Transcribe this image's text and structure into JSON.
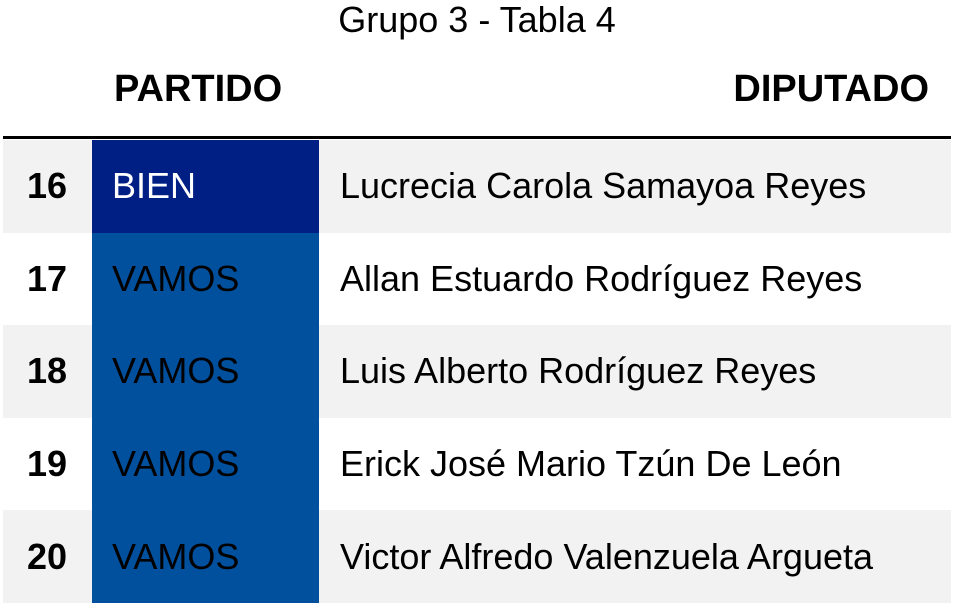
{
  "title": "Grupo 3 - Tabla 4",
  "header": {
    "partido": "PARTIDO",
    "diputado": "DIPUTADO"
  },
  "colors": {
    "BIEN": "#001f84",
    "VAMOS": "#00509e",
    "bien_text": "#ffffff",
    "vamos_text": "#000000"
  },
  "rows": [
    {
      "num": "16",
      "party": "BIEN",
      "name": "Lucrecia Carola Samayoa Reyes"
    },
    {
      "num": "17",
      "party": "VAMOS",
      "name": "Allan Estuardo Rodríguez Reyes"
    },
    {
      "num": "18",
      "party": "VAMOS",
      "name": "Luis Alberto Rodríguez Reyes"
    },
    {
      "num": "19",
      "party": "VAMOS",
      "name": "Erick José Mario Tzún De León"
    },
    {
      "num": "20",
      "party": "VAMOS",
      "name": "Victor Alfredo Valenzuela Argueta"
    }
  ]
}
